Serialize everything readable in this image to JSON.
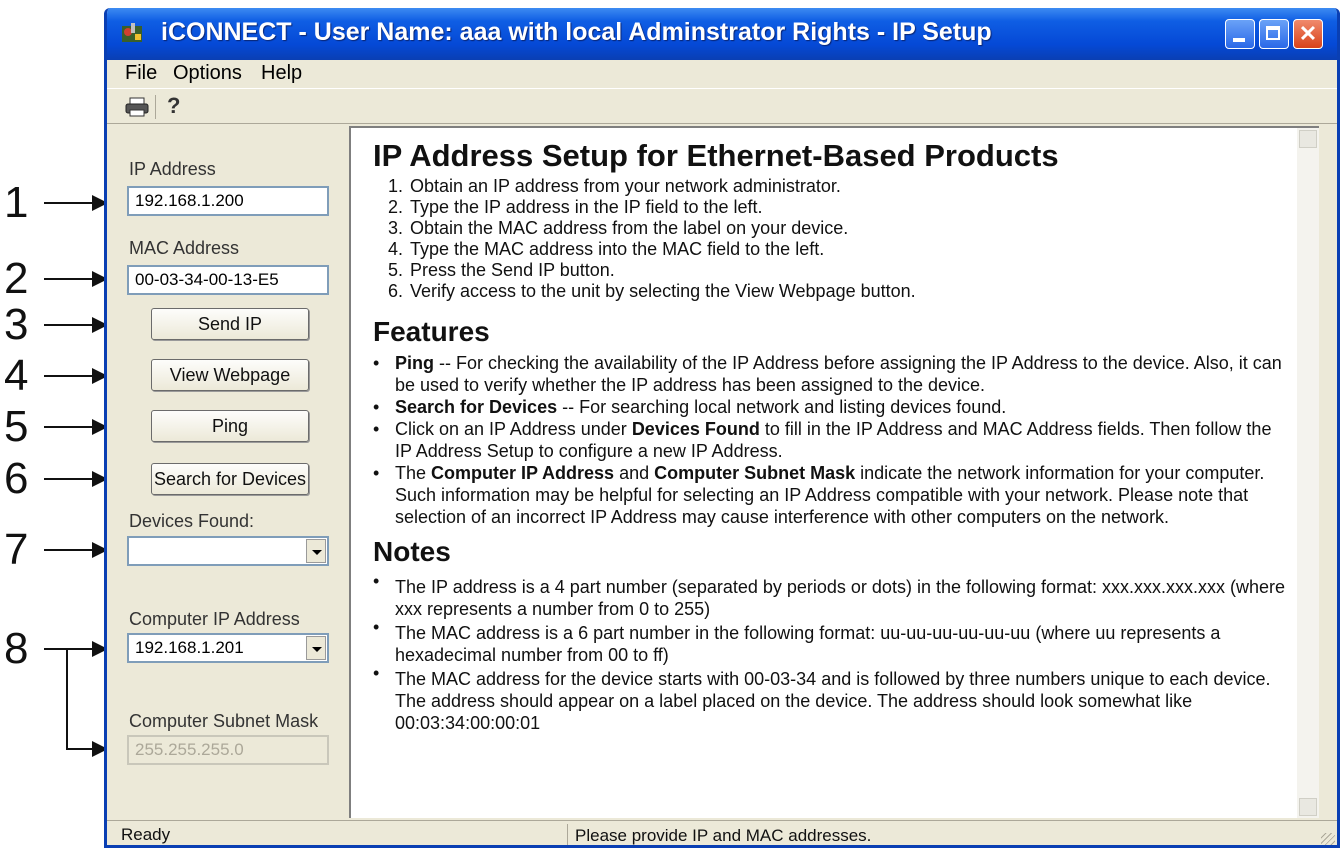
{
  "window": {
    "title": "iCONNECT - User Name: aaa with local Adminstrator Rights - IP Setup"
  },
  "menu": [
    "File",
    "Options",
    "Help"
  ],
  "toolbar": {
    "print_icon": "printer-icon",
    "help_icon": "help-icon"
  },
  "callouts": [
    "1",
    "2",
    "3",
    "4",
    "5",
    "6",
    "7",
    "8"
  ],
  "left_panel": {
    "ip_label": "IP Address",
    "ip_value": "192.168.1.200",
    "mac_label": "MAC Address",
    "mac_value": "00-03-34-00-13-E5",
    "send_ip_button": "Send IP",
    "view_webpage_button": "View Webpage",
    "ping_button": "Ping",
    "search_button": "Search for Devices",
    "devices_found_label": "Devices Found:",
    "devices_found_value": "",
    "computer_ip_label": "Computer IP Address",
    "computer_ip_value": "192.168.1.201",
    "subnet_label": "Computer Subnet Mask",
    "subnet_value": "255.255.255.0"
  },
  "content": {
    "heading": "IP Address Setup for Ethernet-Based Products",
    "steps": [
      "Obtain an IP address from your network administrator.",
      "Type the IP address in the IP field to the left.",
      "Obtain the MAC address from the label on your device.",
      "Type the MAC address into the MAC field to the left.",
      "Press the Send IP button.",
      "Verify access to the unit by selecting the View Webpage button."
    ],
    "features_heading": "Features",
    "features": [
      {
        "bold": "Ping",
        "text": " -- For checking the availability of the IP Address before assigning the IP Address to the device.  Also, it can be used to verify whether the IP address has been assigned to the device."
      },
      {
        "bold": "Search for Devices",
        "text": " -- For searching local network and listing devices found."
      },
      {
        "pre": "Click on an IP Address under ",
        "bold": "Devices Found",
        "text": " to fill in the IP Address and MAC Address fields. Then follow the IP Address Setup to configure a new IP Address."
      },
      {
        "pre": "The ",
        "bold": "Computer IP Address",
        "mid": " and ",
        "bold2": "Computer Subnet Mask",
        "text": " indicate the network information for your computer.  Such information may be helpful for selecting an IP Address compatible with your network.  Please note that selection of an incorrect IP Address may cause interference with other computers on the network."
      }
    ],
    "notes_heading": "Notes",
    "notes": [
      "The IP address is a 4 part number (separated by periods or dots) in the following format: xxx.xxx.xxx.xxx (where xxx represents a number from 0 to 255)",
      "The MAC address is a 6 part number in the following format: uu-uu-uu-uu-uu-uu (where uu represents a hexadecimal number from 00 to ff)",
      "The MAC address for the device starts with 00-03-34 and is followed by three numbers unique to each device. The address should appear on a label placed on the device. The address should look somewhat like 00:03:34:00:00:01"
    ]
  },
  "status": {
    "left": "Ready",
    "right": "Please provide IP and MAC addresses."
  }
}
